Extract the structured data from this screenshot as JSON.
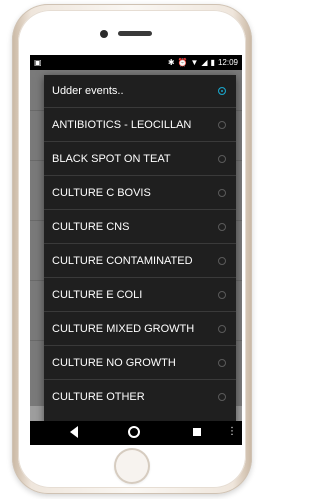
{
  "status_bar": {
    "time": "12:09",
    "icons": [
      "bluetooth-icon",
      "alarm-icon",
      "wifi-icon",
      "signal-icon",
      "battery-icon"
    ],
    "left_icon": "notification-icon"
  },
  "dialog": {
    "title": "Udder events..",
    "selected_index": 0,
    "options": [
      "ANTIBIOTICS - LEOCILLAN",
      "BLACK SPOT ON TEAT",
      "CULTURE C BOVIS",
      "CULTURE CNS",
      "CULTURE CONTAMINATED",
      "CULTURE E COLI",
      "CULTURE MIXED GROWTH",
      "CULTURE NO GROWTH",
      "CULTURE OTHER"
    ]
  },
  "nav_bar": {
    "menu_glyph": "⋮"
  },
  "colors": {
    "accent": "#1aa3c8",
    "dialog_bg": "#1f1f1f",
    "divider": "#3a3a3a"
  }
}
